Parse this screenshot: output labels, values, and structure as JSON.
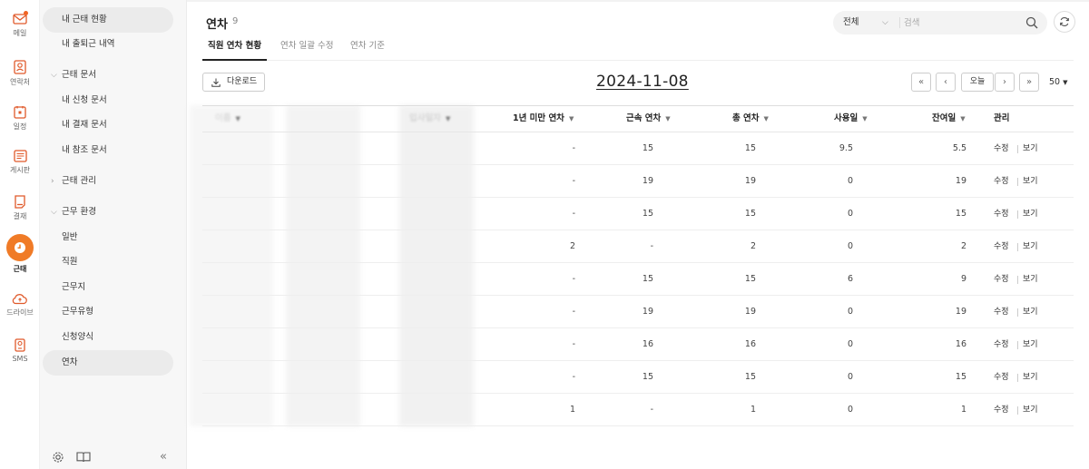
{
  "rail": {
    "items": [
      {
        "label": "메일",
        "icon": "mail-icon"
      },
      {
        "label": "연락처",
        "icon": "contacts-icon"
      },
      {
        "label": "일정",
        "icon": "calendar-icon"
      },
      {
        "label": "게시판",
        "icon": "board-icon"
      },
      {
        "label": "결재",
        "icon": "approval-icon"
      },
      {
        "label": "근태",
        "icon": "clock-icon"
      },
      {
        "label": "드라이브",
        "icon": "drive-icon"
      },
      {
        "label": "SMS",
        "icon": "sms-icon"
      }
    ],
    "active_index": 5,
    "accent_color": "#f07b27"
  },
  "sidebar": {
    "items": [
      {
        "label": "내 근태 현황",
        "type": "link"
      },
      {
        "label": "내 출퇴근 내역",
        "type": "link"
      },
      {
        "label": "근태 문서",
        "type": "section",
        "expanded": true
      },
      {
        "label": "내 신청 문서",
        "type": "link"
      },
      {
        "label": "내 결재 문서",
        "type": "link"
      },
      {
        "label": "내 참조 문서",
        "type": "link"
      },
      {
        "label": "근태 관리",
        "type": "section",
        "expanded": false
      },
      {
        "label": "근무 환경",
        "type": "section",
        "expanded": true
      },
      {
        "label": "일반",
        "type": "link"
      },
      {
        "label": "직원",
        "type": "link"
      },
      {
        "label": "근무지",
        "type": "link"
      },
      {
        "label": "근무유형",
        "type": "link"
      },
      {
        "label": "신청양식",
        "type": "link"
      },
      {
        "label": "연차",
        "type": "link",
        "active": true
      }
    ],
    "collapse_label": "«"
  },
  "header": {
    "title": "연차",
    "count": "9",
    "search": {
      "scope": "전체",
      "placeholder": "검색"
    }
  },
  "tabs": [
    {
      "label": "직원 연차 현황",
      "active": true
    },
    {
      "label": "연차 일괄 수정",
      "active": false
    },
    {
      "label": "연차 기준",
      "active": false
    }
  ],
  "toolbar": {
    "download_label": "다운로드",
    "date": "2024-11-08",
    "first_label": "«",
    "prev_label": "‹",
    "today_label": "오늘",
    "next_label": "›",
    "last_label": "»",
    "page_size": "50"
  },
  "table": {
    "columns": [
      "이름",
      "입사일자",
      "1년 미만 연차",
      "근속 연차",
      "총 연차",
      "사용일",
      "잔여일",
      "관리"
    ],
    "rows": [
      {
        "under_one_year": "-",
        "tenure": "15",
        "total": "15",
        "used": "9.5",
        "remaining": "5.5"
      },
      {
        "under_one_year": "-",
        "tenure": "19",
        "total": "19",
        "used": "0",
        "remaining": "19"
      },
      {
        "under_one_year": "-",
        "tenure": "15",
        "total": "15",
        "used": "0",
        "remaining": "15"
      },
      {
        "under_one_year": "2",
        "tenure": "-",
        "total": "2",
        "used": "0",
        "remaining": "2"
      },
      {
        "under_one_year": "-",
        "tenure": "15",
        "total": "15",
        "used": "6",
        "remaining": "9"
      },
      {
        "under_one_year": "-",
        "tenure": "19",
        "total": "19",
        "used": "0",
        "remaining": "19"
      },
      {
        "under_one_year": "-",
        "tenure": "16",
        "total": "16",
        "used": "0",
        "remaining": "16"
      },
      {
        "under_one_year": "-",
        "tenure": "15",
        "total": "15",
        "used": "0",
        "remaining": "15"
      },
      {
        "under_one_year": "1",
        "tenure": "-",
        "total": "1",
        "used": "0",
        "remaining": "1"
      }
    ],
    "edit_label": "수정",
    "view_label": "보기"
  }
}
